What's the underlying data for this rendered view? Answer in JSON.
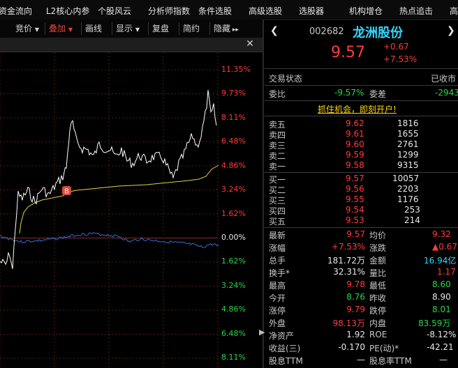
{
  "menu": [
    "资金流向",
    "L2核心内参",
    "个股风云",
    "分析师指数",
    "条件选股",
    "高级选股",
    "选股器",
    "机构增仓",
    "热点追击",
    "高"
  ],
  "toolbar": {
    "items": [
      "竞价",
      "叠加",
      "画线",
      "显示",
      "复盘",
      "简约",
      "隐藏"
    ],
    "close": "✕"
  },
  "chart": {
    "prev_close": 8.9,
    "marker": "B",
    "price_pct_labels": [
      {
        "text": "11.35%",
        "color": "#ff3b3b"
      },
      {
        "text": "9.73%",
        "color": "#ff3b3b"
      },
      {
        "text": "8.11%",
        "color": "#ff3b3b"
      },
      {
        "text": "6.48%",
        "color": "#ff3b3b"
      },
      {
        "text": "4.86%",
        "color": "#ff3b3b"
      },
      {
        "text": "3.24%",
        "color": "#ff3b3b"
      },
      {
        "text": "1.62%",
        "color": "#ff3b3b"
      },
      {
        "text": "0.00%",
        "color": "#e8e8e8"
      },
      {
        "text": "1.62%",
        "color": "#2bd64a"
      },
      {
        "text": "3.24%",
        "color": "#2bd64a"
      },
      {
        "text": "4.86%",
        "color": "#2bd64a"
      },
      {
        "text": "6.48%",
        "color": "#2bd64a"
      },
      {
        "text": "8.11%",
        "color": "#2bd64a"
      }
    ],
    "colors": {
      "price": "#ffffff",
      "avg": "#e8d23a",
      "index": "#2f6fd6",
      "grid": "#5a1a1a",
      "marker": "#d94a3a"
    }
  },
  "quote": {
    "code": "002682",
    "name": "龙洲股份",
    "price": "9.57",
    "change": "+0.67",
    "change_pct": "+7.53%"
  },
  "status": {
    "label": "交易状态",
    "value": "已收市"
  },
  "weibi": {
    "label": "委比",
    "value": "-9.57%",
    "cha_label": "委差",
    "cha_value": "-2943"
  },
  "promo": "抓住机会，即刻开户!",
  "asks": [
    {
      "label": "卖五",
      "price": "9.62",
      "vol": "1816"
    },
    {
      "label": "卖四",
      "price": "9.61",
      "vol": "1655"
    },
    {
      "label": "卖三",
      "price": "9.60",
      "vol": "2761"
    },
    {
      "label": "卖二",
      "price": "9.59",
      "vol": "1299"
    },
    {
      "label": "卖一",
      "price": "9.58",
      "vol": "9315"
    }
  ],
  "bids": [
    {
      "label": "买一",
      "price": "9.57",
      "vol": "10057"
    },
    {
      "label": "买二",
      "price": "9.56",
      "vol": "2203"
    },
    {
      "label": "买三",
      "price": "9.55",
      "vol": "1176"
    },
    {
      "label": "买四",
      "price": "9.54",
      "vol": "253"
    },
    {
      "label": "买五",
      "price": "9.53",
      "vol": "214"
    }
  ],
  "stats": [
    {
      "l1": "最新",
      "v1": "9.57",
      "c1": "#ff3b3b",
      "l2": "均价",
      "v2": "9.32",
      "c2": "#ff3b3b"
    },
    {
      "l1": "涨幅",
      "v1": "+7.53%",
      "c1": "#ff3b3b",
      "l2": "涨跌",
      "v2": "▲0.67",
      "c2": "#ff3b3b"
    },
    {
      "l1": "总手",
      "v1": "181.72万",
      "c1": "#e8e8e8",
      "l2": "金额",
      "v2": "16.94亿",
      "c2": "#33d6ff"
    },
    {
      "l1": "换手*",
      "v1": "32.31%",
      "c1": "#e8e8e8",
      "l2": "量比",
      "v2": "1.17",
      "c2": "#ff3b3b"
    },
    {
      "l1": "最高",
      "v1": "9.78",
      "c1": "#ff3b3b",
      "l2": "最低",
      "v2": "8.60",
      "c2": "#2bd64a"
    },
    {
      "l1": "今开",
      "v1": "8.76",
      "c1": "#2bd64a",
      "l2": "昨收",
      "v2": "8.90",
      "c2": "#e8e8e8"
    },
    {
      "l1": "涨停",
      "v1": "9.79",
      "c1": "#ff3b3b",
      "l2": "跌停",
      "v2": "8.01",
      "c2": "#2bd64a"
    },
    {
      "l1": "外盘",
      "v1": "98.13万",
      "c1": "#ff3b3b",
      "l2": "内盘",
      "v2": "83.59万",
      "c2": "#2bd64a"
    },
    {
      "l1": "净资产",
      "v1": "1.92",
      "c1": "#e8e8e8",
      "l2": "ROE",
      "v2": "-8.12%",
      "c2": "#e8e8e8"
    },
    {
      "l1": "收益(三)",
      "v1": "-0.170",
      "c1": "#e8e8e8",
      "l2": "PE(动)*",
      "v2": "-42.21",
      "c2": "#e8e8e8"
    },
    {
      "l1": "股息TTM",
      "v1": "—",
      "c1": "#e8e8e8",
      "l2": "股息率TTM",
      "v2": "—",
      "c2": "#e8e8e8"
    }
  ]
}
